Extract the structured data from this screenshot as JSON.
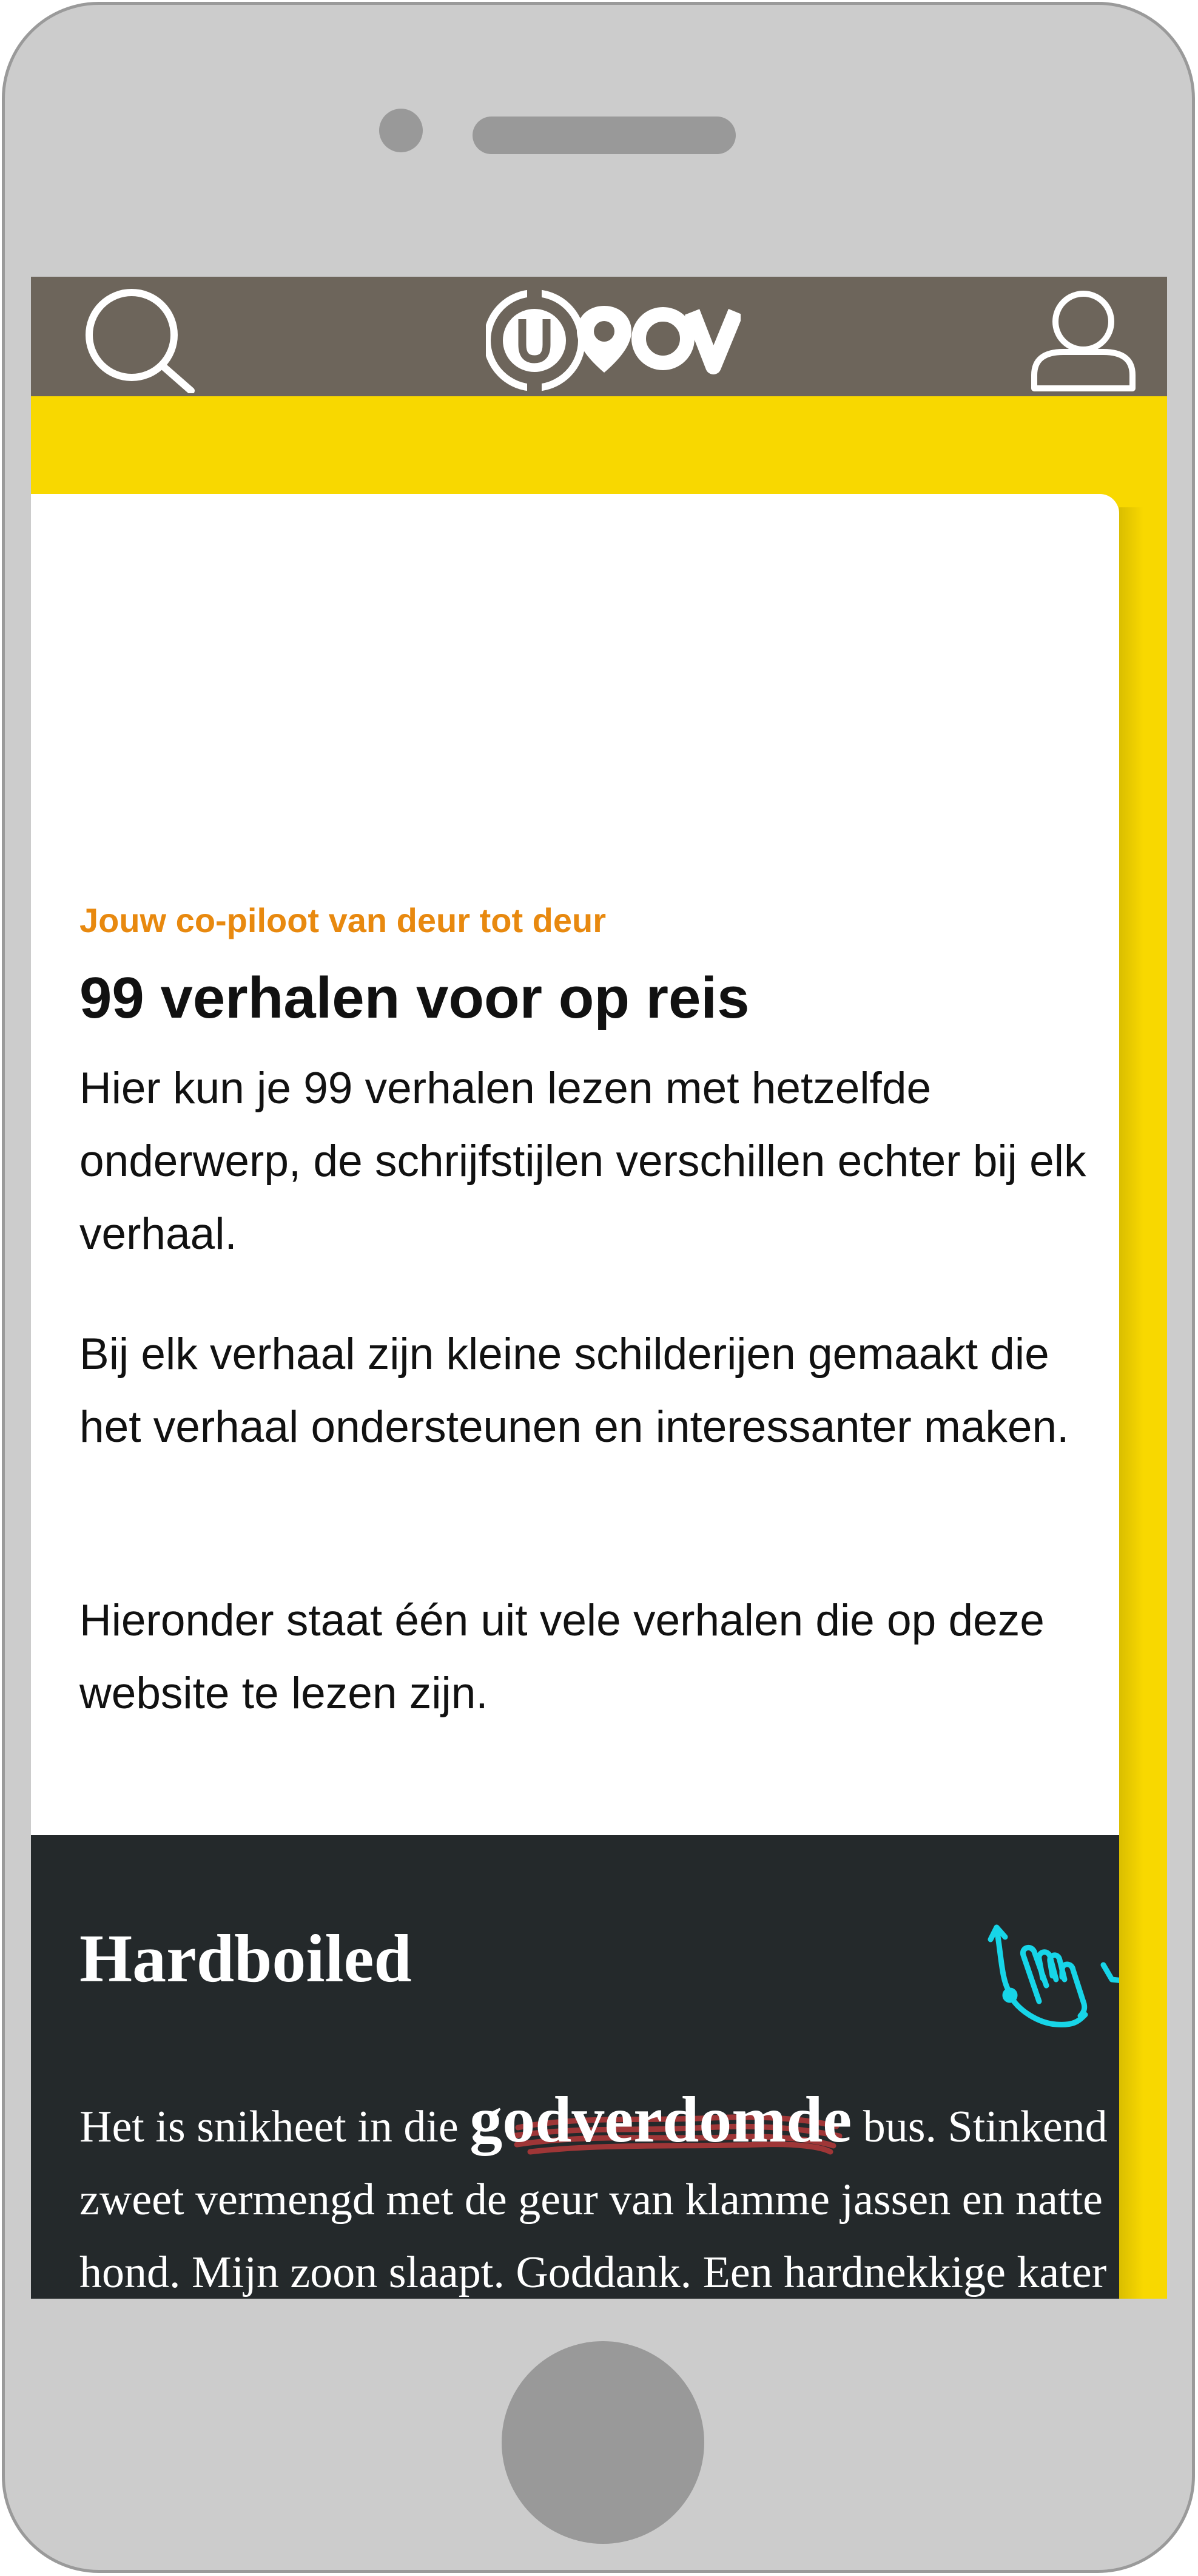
{
  "device": {
    "frame_color": "#cccccc",
    "detail_color": "#999999"
  },
  "header": {
    "background_color": "#6d655b",
    "search_icon": "search-icon",
    "logo_text": "U OV",
    "account_icon": "user-icon"
  },
  "colors": {
    "accent_yellow": "#f8d800",
    "eyebrow_orange": "#e8890f",
    "story_bg": "#24292b",
    "hand_cyan": "#17d5e8",
    "scribble_red": "#b5393a"
  },
  "intro": {
    "eyebrow": "Jouw co-piloot van deur tot deur",
    "title": "99 verhalen voor op reis",
    "paragraphs": [
      "Hier kun je 99 verhalen lezen met hetzelfde onderwerp, de schrijfstijlen verschillen echter bij elk verhaal.",
      "Bij elk verhaal zijn kleine schilderijen gemaakt die het verhaal ondersteunen en interessanter maken.",
      "Hieronder staat één uit vele verhalen die op deze website te lezen zijn."
    ]
  },
  "story": {
    "title": "Hardboiled",
    "interaction_icon": "tap-hand-icon",
    "text_before": "Het is snikheet in die ",
    "highlight": "godverdomde",
    "text_after": " bus. Stinkend zweet vermengd met de geur van klamme jassen en natte hond. Mijn zoon slaapt. Goddank. Een hardnekkige kater bonkt tegen mijn slapen. Flashback naar de avond ervoor. Een fles"
  }
}
